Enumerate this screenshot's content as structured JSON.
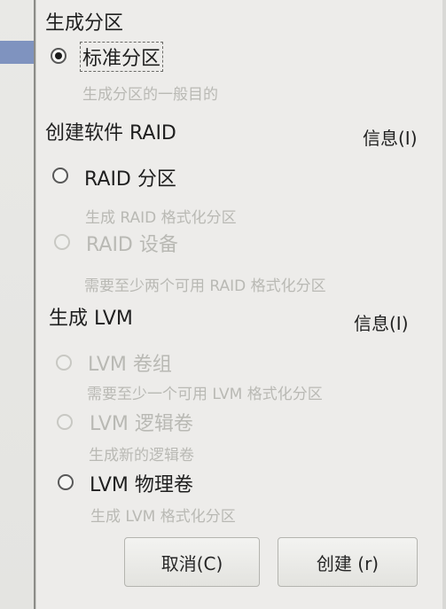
{
  "dialog": {
    "sections": {
      "generate_partition": "生成分区",
      "create_raid": "创建软件 RAID",
      "generate_lvm": "生成 LVM"
    },
    "info_labels": {
      "raid": "信息(I)",
      "lvm": "信息(I)"
    },
    "options": {
      "standard_partition": {
        "label": "标准分区",
        "desc": "生成分区的一般目的"
      },
      "raid_partition": {
        "label": "RAID 分区",
        "desc": "生成 RAID 格式化分区"
      },
      "raid_device": {
        "label": "RAID 设备",
        "desc": "需要至少两个可用 RAID 格式化分区"
      },
      "lvm_volume_group": {
        "label": "LVM 卷组",
        "desc": "需要至少一个可用 LVM 格式化分区"
      },
      "lvm_logical_volume": {
        "label": "LVM 逻辑卷",
        "desc": "生成新的逻辑卷"
      },
      "lvm_physical_volume": {
        "label": "LVM 物理卷",
        "desc": "生成 LVM 格式化分区"
      }
    },
    "buttons": {
      "cancel": "取消(C)",
      "create": "创建 (r)"
    }
  }
}
